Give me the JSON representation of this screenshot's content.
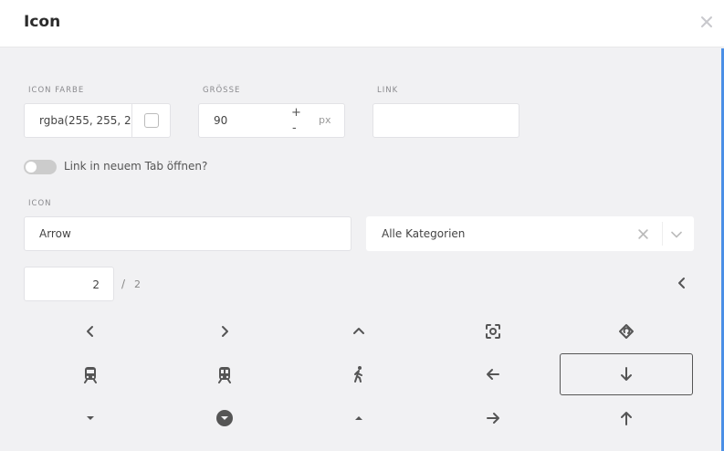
{
  "dialog": {
    "title": "Icon"
  },
  "fields": {
    "color_label": "ICON FARBE",
    "color_value": "rgba(255, 255, 255",
    "size_label": "GRÖSSE",
    "size_value": "90",
    "size_plus": "+",
    "size_minus": "-",
    "size_unit": "px",
    "link_label": "LINK",
    "link_value": "",
    "new_tab_label": "Link in neuem Tab öffnen?",
    "new_tab_enabled": false,
    "icon_label": "ICON",
    "search_value": "Arrow",
    "category_value": "Alle Kategorien"
  },
  "pagination": {
    "current": "2",
    "separator": "/",
    "total": "2"
  },
  "colors": {
    "accent": "#4a8fe6",
    "icon": "#555555",
    "panel": "#f1f1f3"
  },
  "icons": [
    {
      "name": "chevron-left-icon",
      "selected": false
    },
    {
      "name": "chevron-right-icon",
      "selected": false
    },
    {
      "name": "chevron-up-icon",
      "selected": false
    },
    {
      "name": "focus-frame-icon",
      "selected": false
    },
    {
      "name": "rotate-diamond-icon",
      "selected": false
    },
    {
      "name": "train-icon",
      "selected": false
    },
    {
      "name": "subway-icon",
      "selected": false
    },
    {
      "name": "walking-person-icon",
      "selected": false
    },
    {
      "name": "arrow-left-icon",
      "selected": false
    },
    {
      "name": "arrow-down-icon",
      "selected": true
    },
    {
      "name": "caret-down-icon",
      "selected": false
    },
    {
      "name": "circle-caret-down-icon",
      "selected": false
    },
    {
      "name": "caret-up-icon",
      "selected": false
    },
    {
      "name": "arrow-right-icon",
      "selected": false
    },
    {
      "name": "arrow-up-icon",
      "selected": false
    }
  ]
}
